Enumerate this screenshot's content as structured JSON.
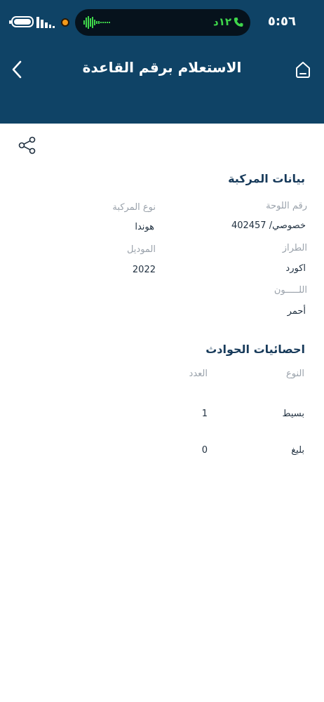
{
  "status_bar": {
    "time": "٥:٥٦",
    "call_duration": "١٢د",
    "colors": {
      "call": "#3fd64b",
      "recording": "#f49a1b"
    }
  },
  "app_bar": {
    "title": "الاستعلام برقم القاعدة",
    "background": "#0f4366"
  },
  "vehicle": {
    "section_title": "بيانات المركبة",
    "plate_label": "رقم اللوحة",
    "plate_value": "خصوصي/ 402457",
    "type_label": "نوع المركبة",
    "type_value": "هوندا",
    "model_label": "الطراز",
    "model_value": "اكورد",
    "year_label": "الموديل",
    "year_value": "2022",
    "color_label": "اللـــــون",
    "color_value": "أحمر"
  },
  "accidents": {
    "section_title": "احصائيات الحوادث",
    "header_type": "النوع",
    "header_count": "العدد",
    "rows": [
      {
        "type": "بسيط",
        "count": "1"
      },
      {
        "type": "بليغ",
        "count": "0"
      }
    ]
  }
}
